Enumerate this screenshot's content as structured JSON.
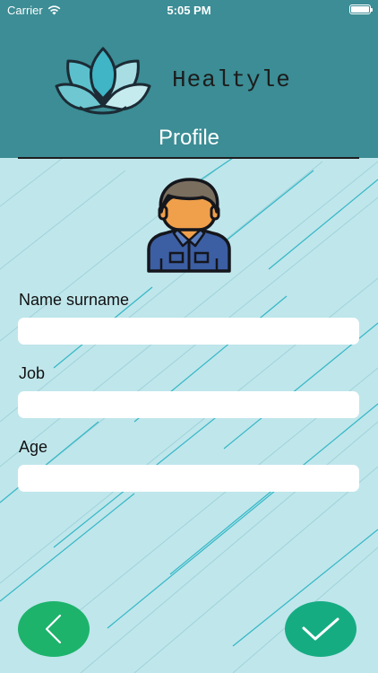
{
  "status_bar": {
    "carrier": "Carrier",
    "time": "5:05 PM"
  },
  "header": {
    "brand": "Healtyle",
    "title": "Profile",
    "logo_icon": "lotus-icon"
  },
  "avatar": {
    "icon": "user-avatar-icon"
  },
  "form": {
    "name_label": "Name surname",
    "name_value": "",
    "job_label": "Job",
    "job_value": "",
    "age_label": "Age",
    "age_value": ""
  },
  "buttons": {
    "back_icon": "chevron-left-icon",
    "confirm_icon": "checkmark-icon"
  },
  "colors": {
    "header_bg": "#3c8d95",
    "page_bg": "#bfe6eb",
    "back_button": "#1db36b",
    "confirm_button": "#16ac82"
  }
}
